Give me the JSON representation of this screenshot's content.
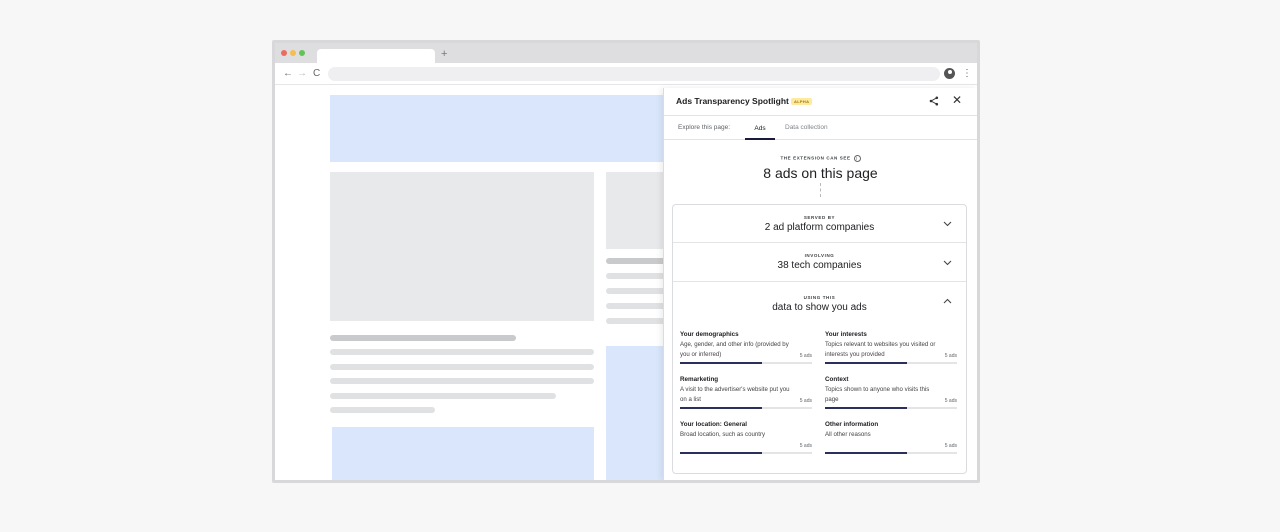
{
  "browser": {
    "new_tab_icon": "+",
    "back_icon": "←",
    "forward_icon": "→",
    "reload_icon": "C",
    "menu_icon": "⋮"
  },
  "panel": {
    "title": "Ads Transparency Spotlight",
    "badge": "ALPHA",
    "share_icon": "<",
    "close_icon": "✕",
    "explore_label": "Explore this page:",
    "tabs": [
      "Ads",
      "Data collection"
    ],
    "active_tab": "Ads",
    "summary": {
      "label": "THE EXTENSION CAN SEE",
      "info_icon": "i",
      "count_text": "8 ads on this page"
    },
    "sections": [
      {
        "label": "SERVED BY",
        "text": "2 ad platform companies",
        "chevron": "⌄"
      },
      {
        "label": "INVOLVING",
        "text": "38 tech companies",
        "chevron": "⌄"
      },
      {
        "label": "USING THIS",
        "text": "data to show you ads",
        "chevron": "⌃"
      }
    ],
    "data_types": [
      {
        "title": "Your demographics",
        "description": "Age, gender, and other info (provided by you or inferred)",
        "ads": "5 ads",
        "fill": 0.62
      },
      {
        "title": "Your interests",
        "description": "Topics relevant to websites you visited or interests you provided",
        "ads": "5 ads",
        "fill": 0.62
      },
      {
        "title": "Remarketing",
        "description": "A visit to the advertiser's website put you on a list",
        "ads": "5 ads",
        "fill": 0.62
      },
      {
        "title": "Context",
        "description": "Topics shown to anyone who visits this page",
        "ads": "5 ads",
        "fill": 0.62
      },
      {
        "title": "Your location: General",
        "description": "Broad location, such as country",
        "ads": "5 ads",
        "fill": 0.62
      },
      {
        "title": "Other information",
        "description": "All other reasons",
        "ads": "5 ads",
        "fill": 0.62
      }
    ]
  }
}
